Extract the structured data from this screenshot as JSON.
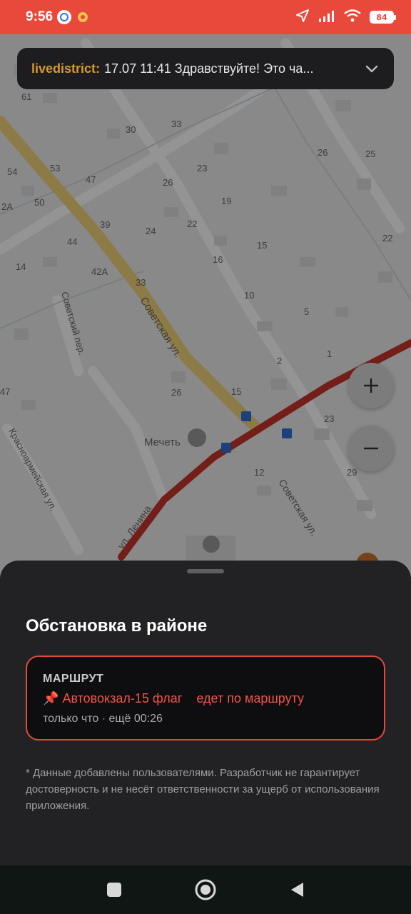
{
  "status_bar": {
    "time": "9:56",
    "battery": "84",
    "icons": [
      "messenger-icon",
      "app-badge-icon",
      "location-arrow-icon",
      "signal-icon",
      "wifi-icon",
      "battery-icon"
    ]
  },
  "notification": {
    "sender": "livedistrict:",
    "text": "17.07 11:41 Здравствуйте! Это ча..."
  },
  "map": {
    "street_labels": [
      "Советская ул.",
      "Советский пер.",
      "Красноармейская ул.",
      "Советская ул.",
      "ул. Ленина",
      "Мечеть"
    ],
    "house_numbers": [
      "61",
      "30",
      "33",
      "53",
      "23",
      "26",
      "25",
      "54",
      "47",
      "26",
      "19",
      "50",
      "39",
      "22",
      "44",
      "24",
      "15",
      "16",
      "42А",
      "33",
      "14",
      "10",
      "5",
      "1",
      "2",
      "26",
      "15",
      "23",
      "47",
      "12",
      "29",
      "2А",
      "22"
    ],
    "poi": "Мечеть"
  },
  "zoom": {
    "in_label": "+",
    "out_label": "−"
  },
  "sheet": {
    "title": "Обстановка в районе",
    "event": {
      "category": "МАРШРУТ",
      "pin": "📌",
      "name": "Автовокзал-15 флаг",
      "status": "едет по маршруту",
      "meta": "только что · ещё 00:26"
    },
    "disclaimer": "* Данные добавлены пользователями. Разработчик не гарантирует достоверность и не несёт ответственности за ущерб от использования приложения."
  },
  "colors": {
    "status_bar": "#e9493b",
    "accent": "#e04a3d",
    "sender": "#d69a2b",
    "sheet_bg": "#222224"
  }
}
